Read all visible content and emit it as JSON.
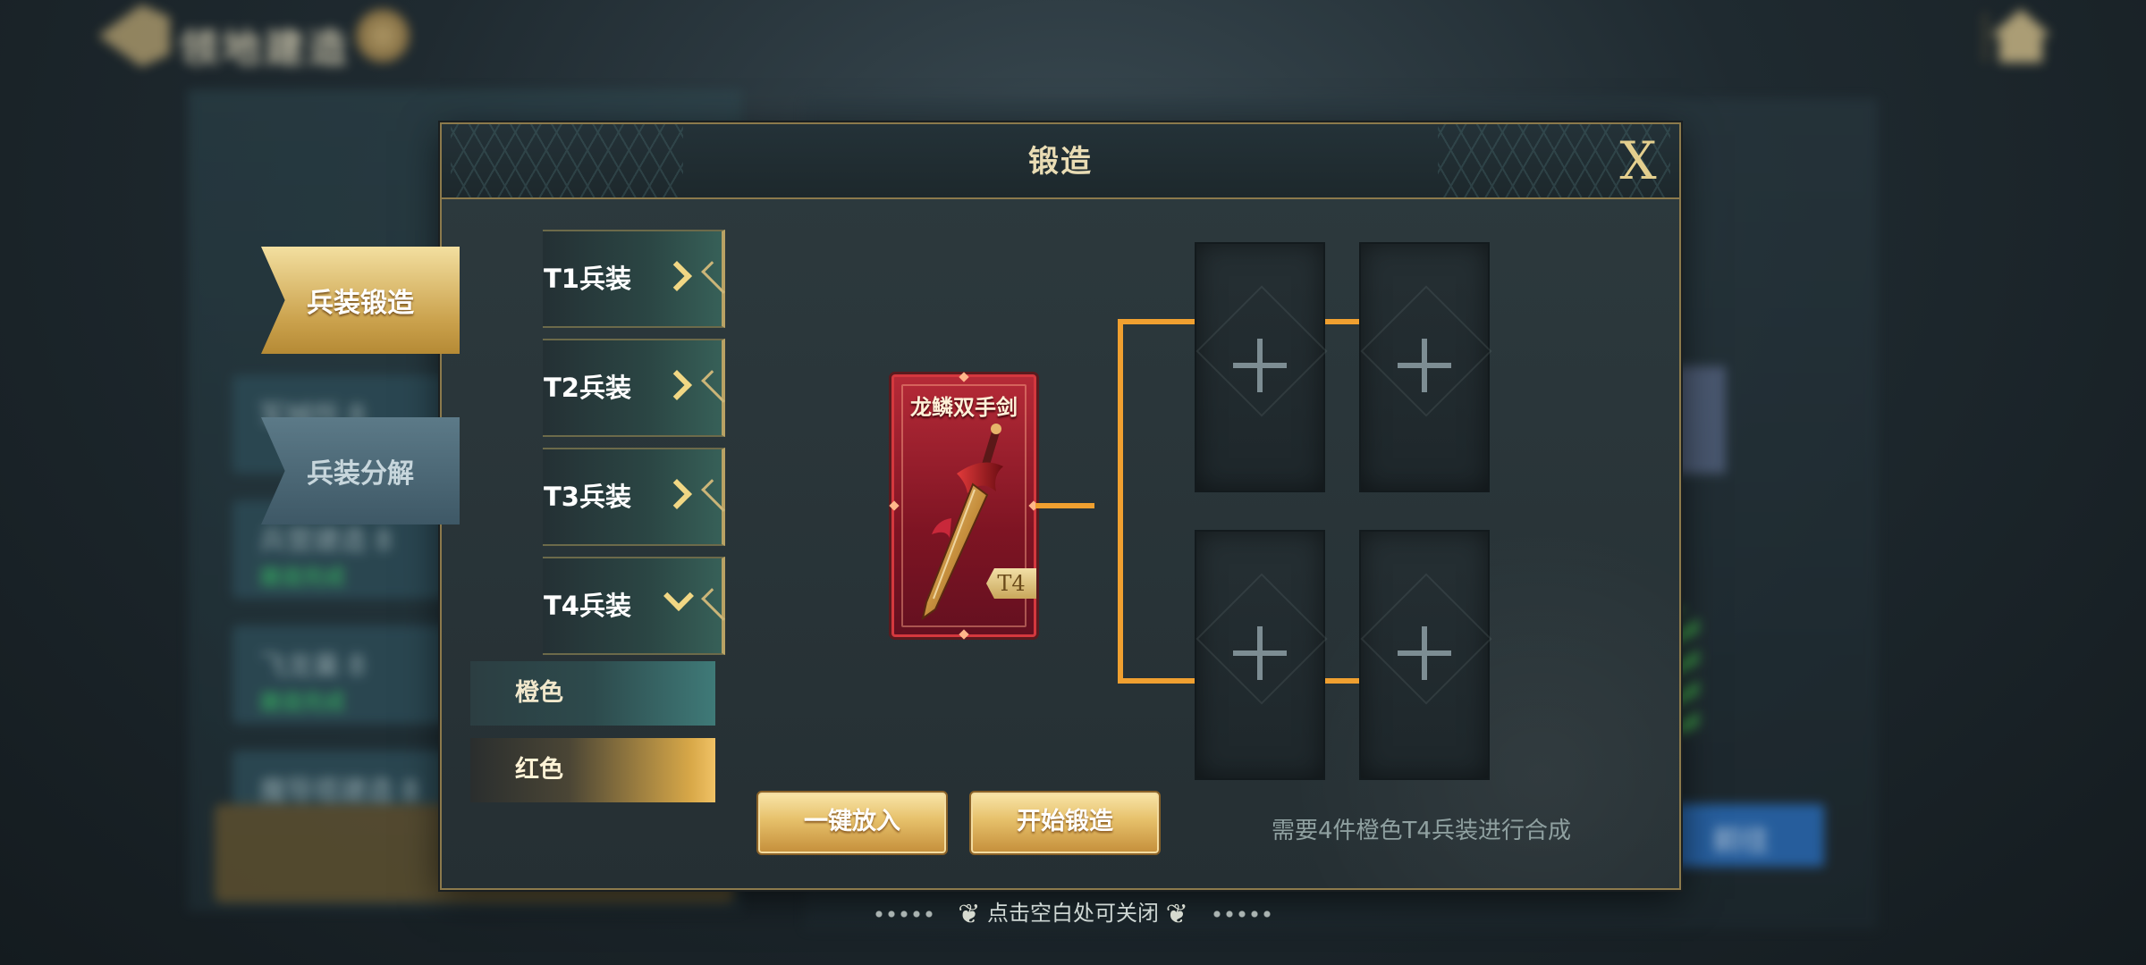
{
  "background": {
    "top_title": "领地建造",
    "left_cards": [
      {
        "label": "军械所 8",
        "sub": ""
      },
      {
        "label": "兵营建造 8",
        "sub": "建造完成"
      },
      {
        "label": "飞龙巢 8",
        "sub": "建造完成"
      },
      {
        "label": "魔导塔建造 8",
        "sub": ""
      }
    ],
    "tab_header": "领地建造",
    "right_button": "前往"
  },
  "dialog": {
    "title": "锻造",
    "close_label": "X",
    "side_tabs": [
      {
        "label": "兵装锻造",
        "active": true
      },
      {
        "label": "兵装分解",
        "active": false
      }
    ],
    "tiers": [
      {
        "label": "T1兵装",
        "state": "collapsed"
      },
      {
        "label": "T2兵装",
        "state": "collapsed"
      },
      {
        "label": "T3兵装",
        "state": "collapsed"
      },
      {
        "label": "T4兵装",
        "state": "expanded"
      }
    ],
    "subcategories": [
      {
        "label": "橙色",
        "selected": false
      },
      {
        "label": "红色",
        "selected": true
      }
    ],
    "target_item": {
      "name": "龙鳞双手剑",
      "tier_badge": "T4",
      "rarity_color": "#b52a37"
    },
    "material_slots": [
      {
        "state": "empty",
        "icon": "plus-icon"
      },
      {
        "state": "empty",
        "icon": "plus-icon"
      },
      {
        "state": "empty",
        "icon": "plus-icon"
      },
      {
        "state": "empty",
        "icon": "plus-icon"
      }
    ],
    "buttons": {
      "auto_fill": "一键放入",
      "start_forge": "开始锻造"
    },
    "requirement_hint": "需要4件橙色T4兵装进行合成"
  },
  "close_hint": "点击空白处可关闭",
  "colors": {
    "accent_gold": "#e6c06a",
    "connector": "#f0a030",
    "red_rarity": "#b52a37"
  }
}
